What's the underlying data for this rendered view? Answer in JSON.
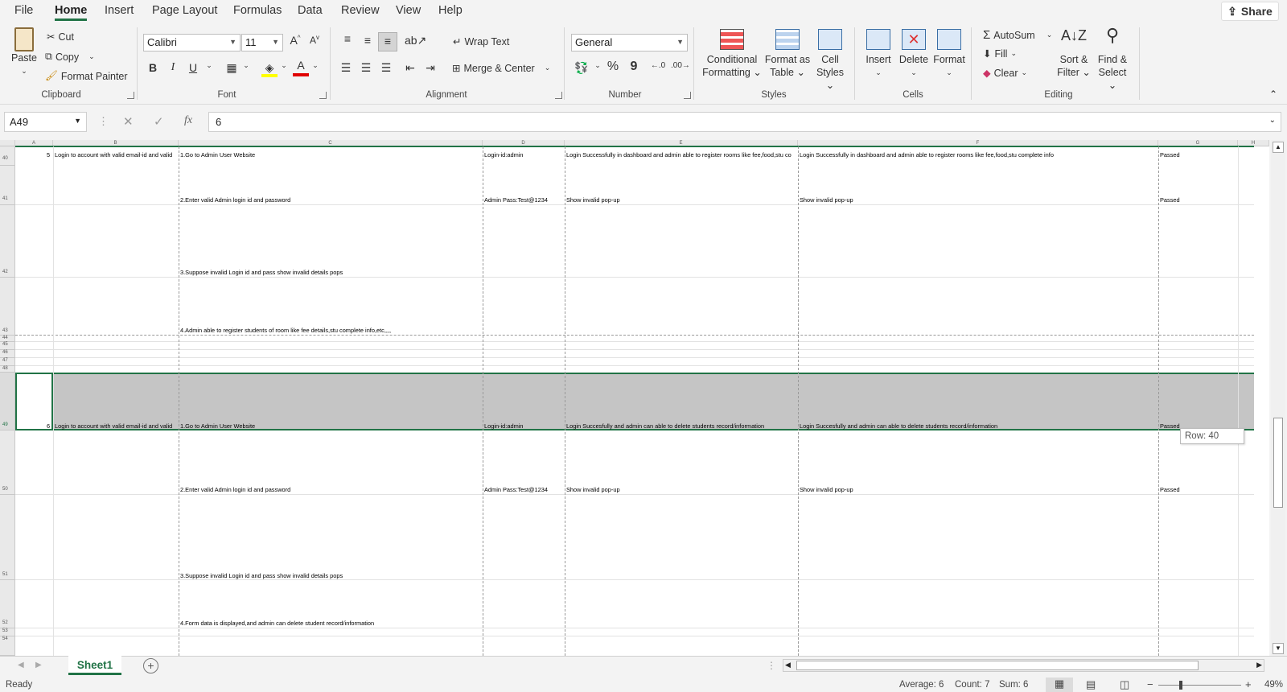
{
  "menu_tabs": [
    "File",
    "Home",
    "Insert",
    "Page Layout",
    "Formulas",
    "Data",
    "Review",
    "View",
    "Help"
  ],
  "active_tab": "Home",
  "share_label": "Share",
  "ribbon": {
    "clipboard": {
      "paste": "Paste",
      "cut": "Cut",
      "copy": "Copy",
      "format_painter": "Format Painter",
      "label": "Clipboard"
    },
    "font": {
      "name": "Calibri",
      "size": "11",
      "bold": "B",
      "italic": "I",
      "underline": "U",
      "label": "Font"
    },
    "alignment": {
      "wrap_text": "Wrap Text",
      "merge_center": "Merge & Center",
      "label": "Alignment"
    },
    "number": {
      "format": "General",
      "percent": "%",
      "comma": "9",
      "label": "Number"
    },
    "styles": {
      "conditional_1": "Conditional",
      "conditional_2": "Formatting",
      "format_table_1": "Format as",
      "format_table_2": "Table",
      "cell_styles_1": "Cell",
      "cell_styles_2": "Styles",
      "label": "Styles"
    },
    "cells": {
      "insert": "Insert",
      "delete": "Delete",
      "format": "Format",
      "label": "Cells"
    },
    "editing": {
      "autosum": "AutoSum",
      "fill": "Fill",
      "clear": "Clear",
      "sort_1": "Sort &",
      "sort_2": "Filter",
      "find_1": "Find &",
      "find_2": "Select",
      "label": "Editing"
    }
  },
  "formula_bar": {
    "name_box": "A49",
    "fx": "fx",
    "value": "6"
  },
  "columns": [
    "A",
    "B",
    "C",
    "D",
    "E",
    "F",
    "G",
    "H"
  ],
  "rows": {
    "r40": {
      "num": "40",
      "a": "5",
      "b": "Login to account with valid email-id and valid",
      "c": "1.Go to Admin User Website",
      "d": "Login-id:admin",
      "e": "Login Successfully in dashboard and admin able to register rooms like fee,food,stu co",
      "f": "Login Successfully in dashboard and admin able to register rooms like fee,food,stu complete info",
      "g": "Passed"
    },
    "r41": {
      "num": "41",
      "c": "2.Enter valid Admin login id and password",
      "d": "Admin Pass:Test@1234",
      "e": "Show invalid  pop-up",
      "f": "Show invalid  pop-up",
      "g": "Passed"
    },
    "r42": {
      "num": "42",
      "c": "3.Suppose invalid  Login id and pass show invalid details pops"
    },
    "r43": {
      "num": "43",
      "c": "4.Admin able to register students of room like fee details,stu complete info,etc,,,,"
    },
    "r44": "44",
    "r45": "45",
    "r46": "46",
    "r47": "47",
    "r48": "48",
    "r49": {
      "num": "49",
      "a": "6",
      "b": "Login to account with valid email-id and valid",
      "c": "1.Go to Admin User Website",
      "d": "Login-id:admin",
      "e": "Login Succesfully and admin can able to delete students record/information",
      "f": "Login Succesfully and admin can able to delete students record/information",
      "g": "Passed"
    },
    "r50": {
      "num": "50",
      "c": "2.Enter valid Admin login id and password",
      "d": "Admin Pass:Test@1234",
      "e": "Show invalid  pop-up",
      "f": "Show invalid  pop-up",
      "g": "Passed"
    },
    "r51": {
      "num": "51",
      "c": "3.Suppose invalid  Login id and pass show invalid details pops"
    },
    "r52": {
      "num": "52",
      "c": "4.Form data is displayed,and admin can delete student record/information"
    },
    "r53": "53",
    "r54": "54"
  },
  "tooltip": "Row: 40",
  "sheet_tab": "Sheet1",
  "status": {
    "ready": "Ready",
    "average": "Average: 6",
    "count": "Count: 7",
    "sum": "Sum: 6",
    "zoom": "49%"
  }
}
